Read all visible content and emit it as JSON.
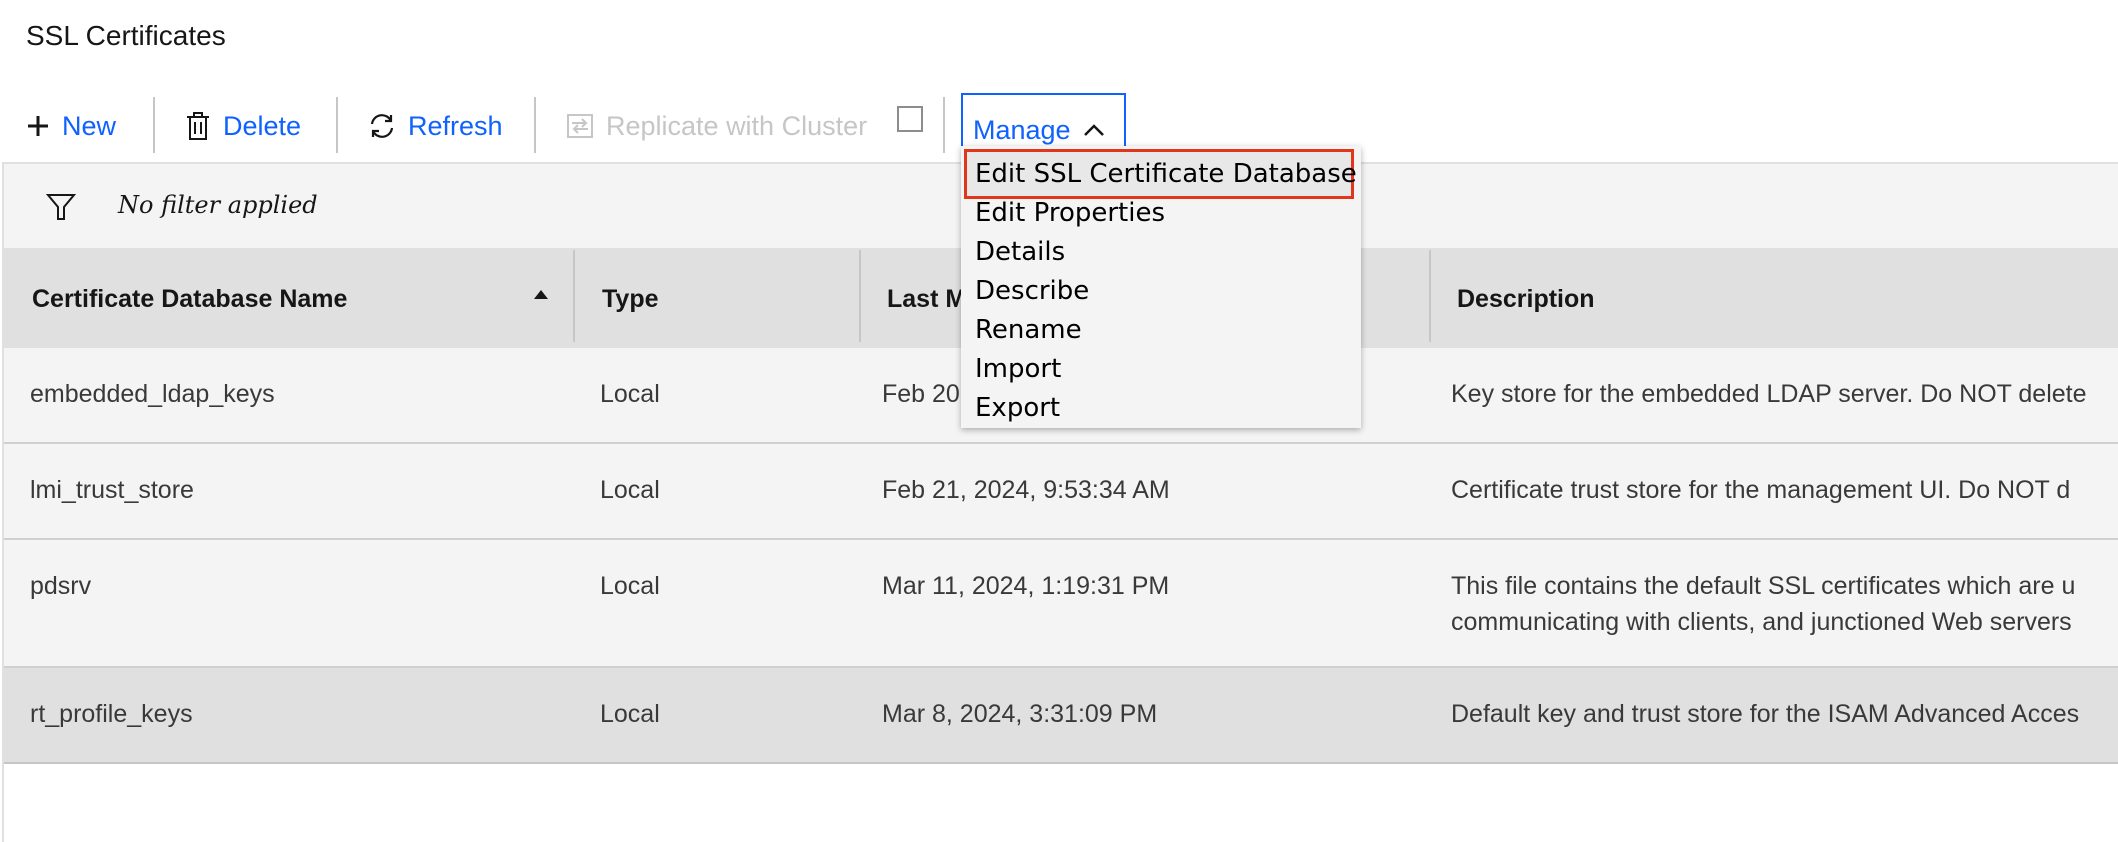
{
  "page": {
    "title": "SSL Certificates"
  },
  "toolbar": {
    "new_label": "New",
    "delete_label": "Delete",
    "refresh_label": "Refresh",
    "replicate_label": "Replicate with Cluster",
    "manage_label": "Manage"
  },
  "filter": {
    "text": "No filter applied"
  },
  "table": {
    "columns": [
      "Certificate Database Name",
      "Type",
      "Last Modified",
      "Description"
    ],
    "rows": [
      {
        "name": "embedded_ldap_keys",
        "type": "Local",
        "modified": "Feb 20",
        "description": "Key store for the embedded LDAP server. Do NOT delete"
      },
      {
        "name": "lmi_trust_store",
        "type": "Local",
        "modified": "Feb 21, 2024, 9:53:34 AM",
        "description": "Certificate trust store for the management UI. Do NOT d"
      },
      {
        "name": "pdsrv",
        "type": "Local",
        "modified": "Mar 11, 2024, 1:19:31 PM",
        "description": "This file contains the default SSL certificates which are u",
        "description_line2": "communicating with clients, and junctioned Web servers"
      },
      {
        "name": "rt_profile_keys",
        "type": "Local",
        "modified": "Mar 8, 2024, 3:31:09 PM",
        "description": "Default key and trust store for the ISAM Advanced Acces"
      }
    ]
  },
  "manage_menu": {
    "items": [
      "Edit SSL Certificate Database",
      "Edit Properties",
      "Details",
      "Describe",
      "Rename",
      "Import",
      "Export"
    ]
  },
  "colors": {
    "accent": "#0f62fe",
    "highlight_border": "#e0371c",
    "disabled": "#c6c6c6"
  }
}
